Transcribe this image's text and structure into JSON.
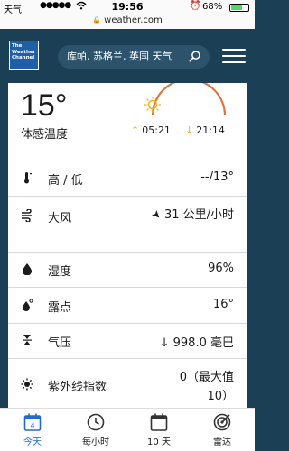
{
  "status": {
    "carrier": "天气",
    "signal": "●●●●●",
    "time": "19:56",
    "battery_pct": "68%",
    "battery_level": 0.68
  },
  "browser": {
    "url": "weather.com"
  },
  "header": {
    "logo_text": "The Weather Channel",
    "search_text": "库帕, 苏格兰, 英国 天气"
  },
  "current": {
    "temperature": "15°",
    "feels_like_label": "体感温度",
    "sunrise": "05:21",
    "sunset": "21:14"
  },
  "details": [
    {
      "icon": "thermometer-icon",
      "label": "高 / 低",
      "value": "--/13°"
    },
    {
      "icon": "wind-icon",
      "label": "大风",
      "value": "31 公里/小时"
    },
    {
      "icon": "humidity-icon",
      "label": "湿度",
      "value": "96%"
    },
    {
      "icon": "dewpoint-icon",
      "label": "露点",
      "value": "16°"
    },
    {
      "icon": "pressure-icon",
      "label": "气压",
      "value": "998.0 毫巴"
    },
    {
      "icon": "uv-icon",
      "label": "紫外线指数",
      "value": "0（最大值 10）"
    }
  ],
  "nav": [
    {
      "icon": "calendar-today-icon",
      "label": "今天",
      "badge": "4",
      "active": true
    },
    {
      "icon": "clock-icon",
      "label": "每小时",
      "active": false
    },
    {
      "icon": "calendar-icon",
      "label": "10 天",
      "active": false
    },
    {
      "icon": "radar-icon",
      "label": "雷达",
      "active": false
    }
  ],
  "colors": {
    "brand_dark": "#1b3f55",
    "accent_orange": "#e2733a",
    "sun_yellow": "#f0b21a",
    "active_blue": "#1f6bd0"
  }
}
